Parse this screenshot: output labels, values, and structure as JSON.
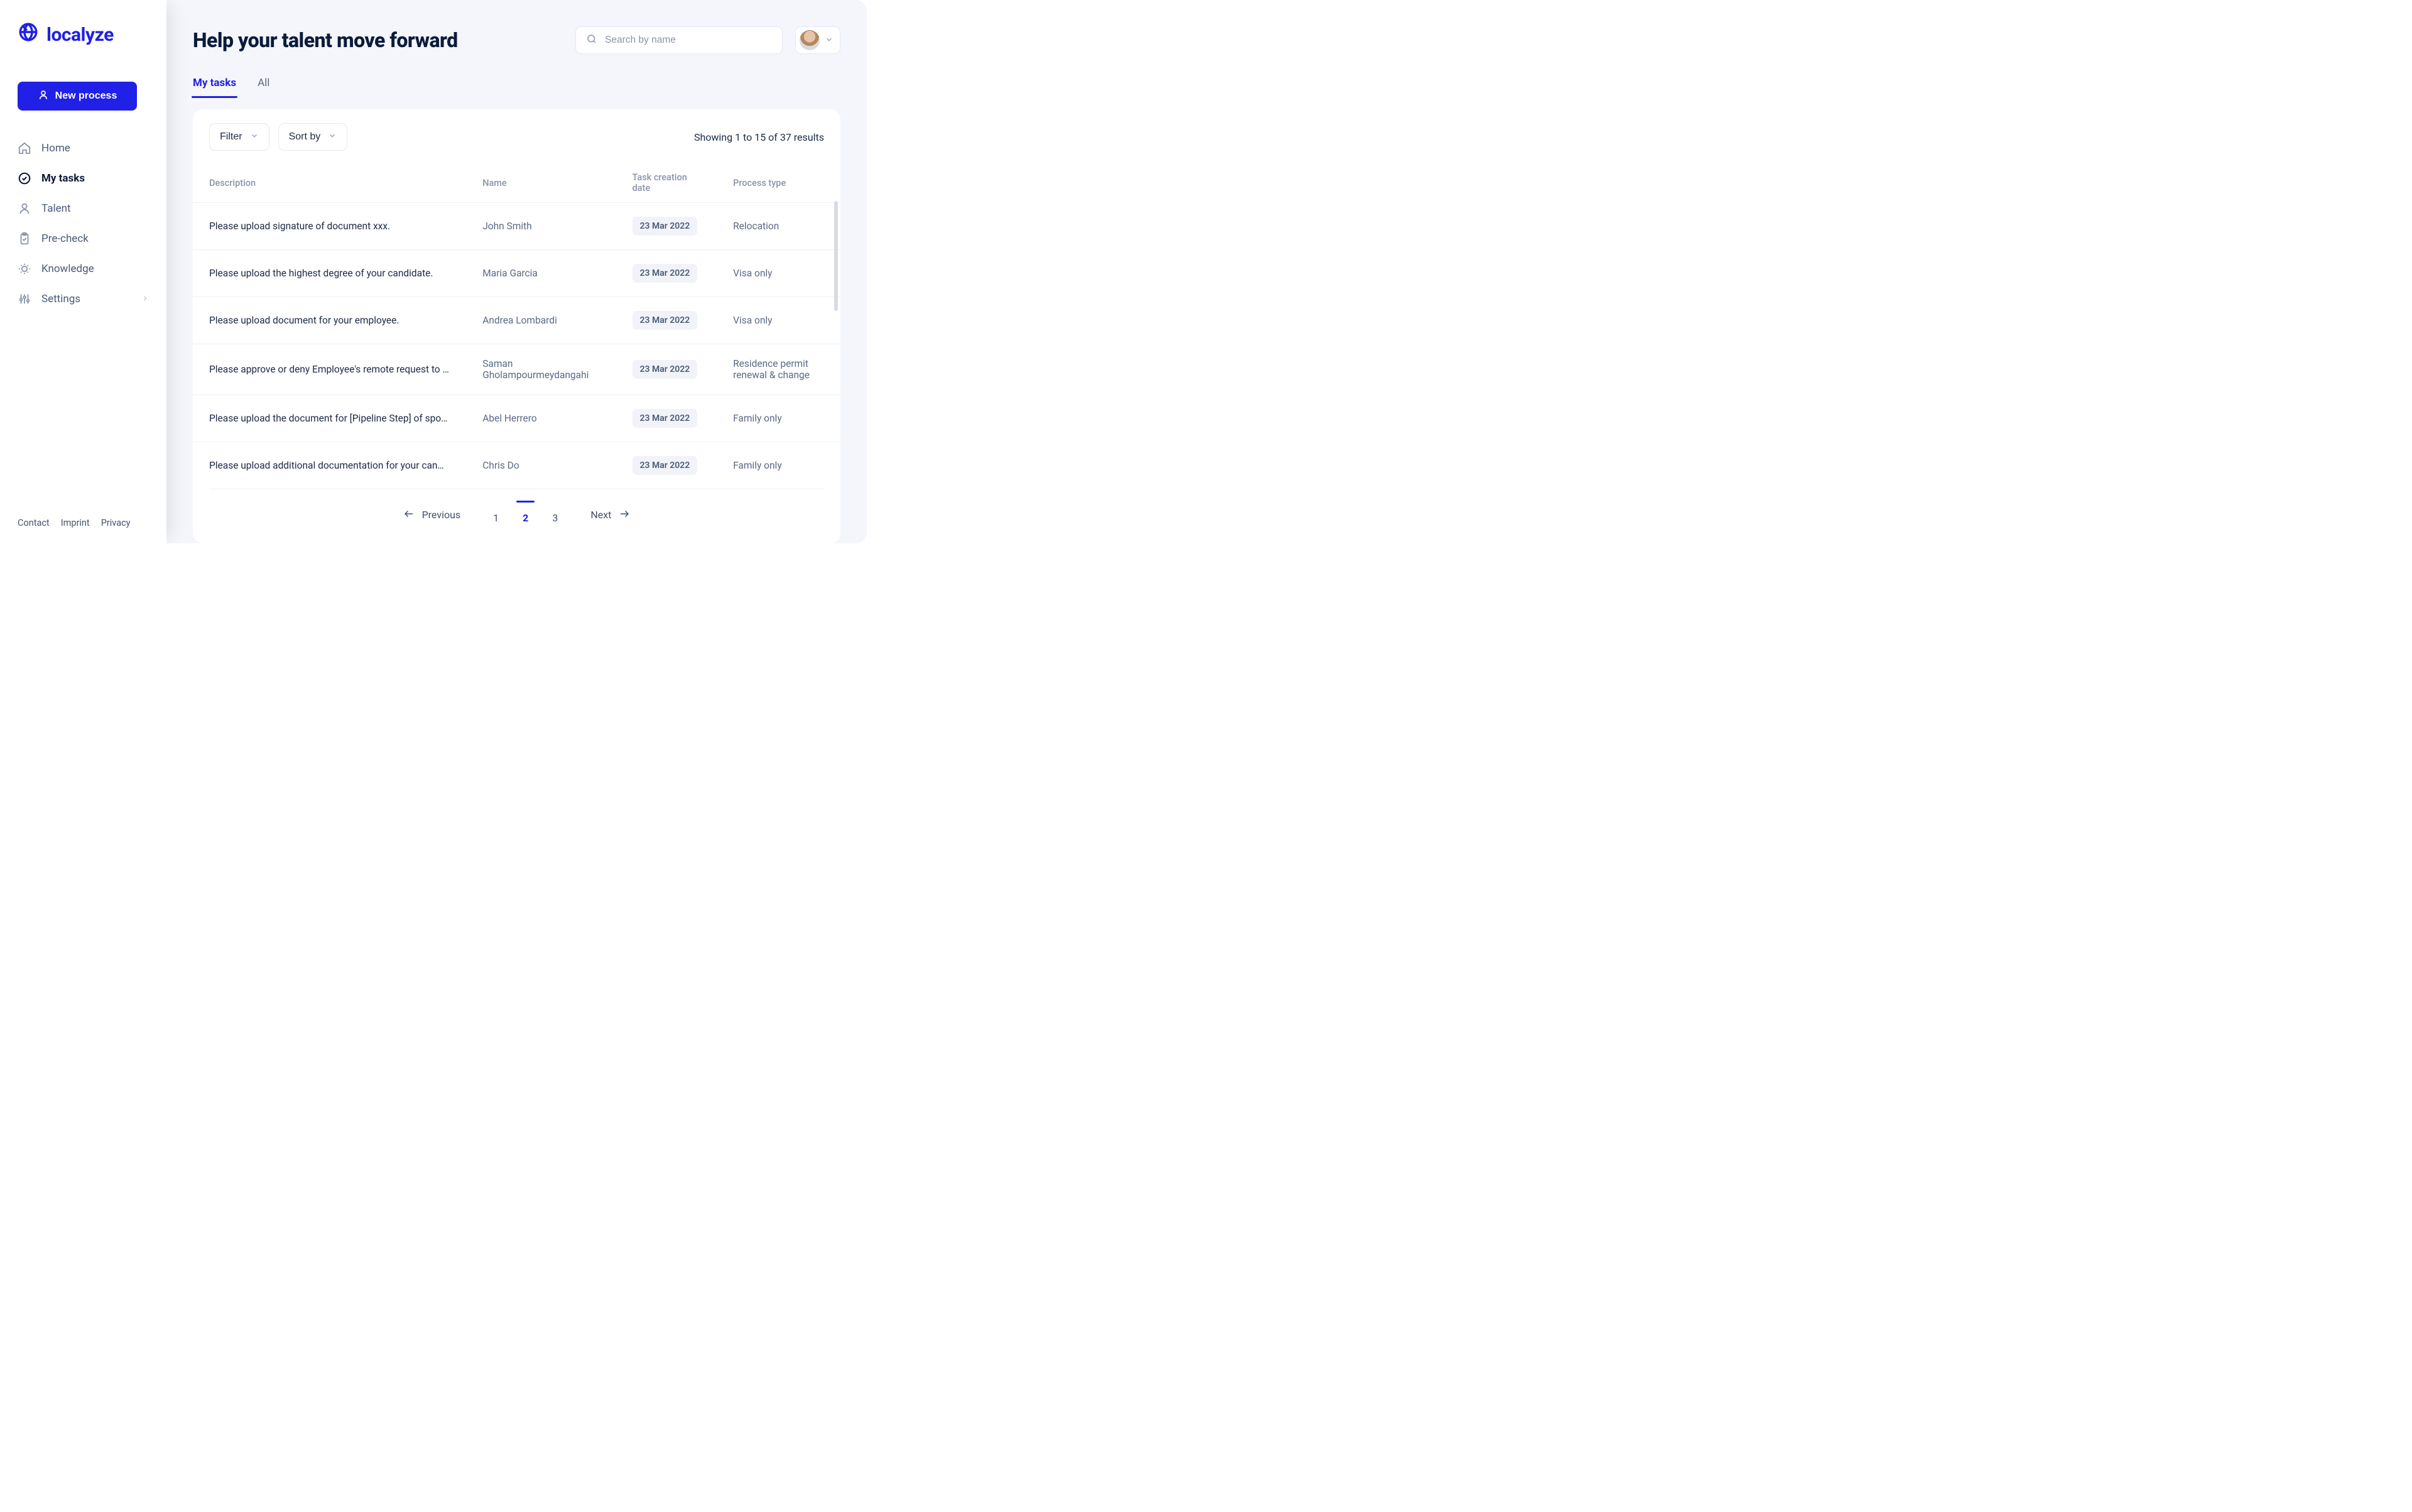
{
  "brand": {
    "name": "localyze"
  },
  "sidebar": {
    "new_process_label": "New process",
    "nav": [
      {
        "id": "home",
        "label": "Home"
      },
      {
        "id": "my-tasks",
        "label": "My tasks"
      },
      {
        "id": "talent",
        "label": "Talent"
      },
      {
        "id": "pre-check",
        "label": "Pre-check"
      },
      {
        "id": "knowledge",
        "label": "Knowledge"
      },
      {
        "id": "settings",
        "label": "Settings"
      }
    ],
    "footer": {
      "contact": "Contact",
      "imprint": "Imprint",
      "privacy": "Privacy"
    }
  },
  "header": {
    "title": "Help your talent move forward",
    "search_placeholder": "Search by name"
  },
  "tabs": [
    {
      "id": "my-tasks",
      "label": "My tasks",
      "active": true
    },
    {
      "id": "all",
      "label": "All",
      "active": false
    }
  ],
  "toolbar": {
    "filter_label": "Filter",
    "sort_label": "Sort by",
    "result_text": "Showing 1 to 15 of 37 results"
  },
  "table": {
    "headers": {
      "description": "Description",
      "name": "Name",
      "date": "Task creation date",
      "ptype": "Process type"
    },
    "rows": [
      {
        "description": "Please upload signature of document xxx.",
        "name": "John Smith",
        "date": "23 Mar 2022",
        "ptype": "Relocation"
      },
      {
        "description": "Please upload the highest degree of your candidate.",
        "name": "Maria Garcia",
        "date": "23 Mar 2022",
        "ptype": "Visa only"
      },
      {
        "description": "Please upload document for your employee.",
        "name": "Andrea Lombardi",
        "date": "23 Mar 2022",
        "ptype": "Visa only"
      },
      {
        "description": "Please approve or deny Employee's remote request to …",
        "name": "Saman Gholampourmeydangahi",
        "date": "23 Mar 2022",
        "ptype": "Residence permit renewal & change"
      },
      {
        "description": "Please upload the document for [Pipeline Step] of spo…",
        "name": "Abel Herrero",
        "date": "23 Mar 2022",
        "ptype": "Family only"
      },
      {
        "description": "Please upload additional documentation for your can…",
        "name": "Chris Do",
        "date": "23 Mar 2022",
        "ptype": "Family only"
      }
    ]
  },
  "pagination": {
    "previous": "Previous",
    "next": "Next",
    "pages": [
      "1",
      "2",
      "3"
    ],
    "current": "2"
  }
}
